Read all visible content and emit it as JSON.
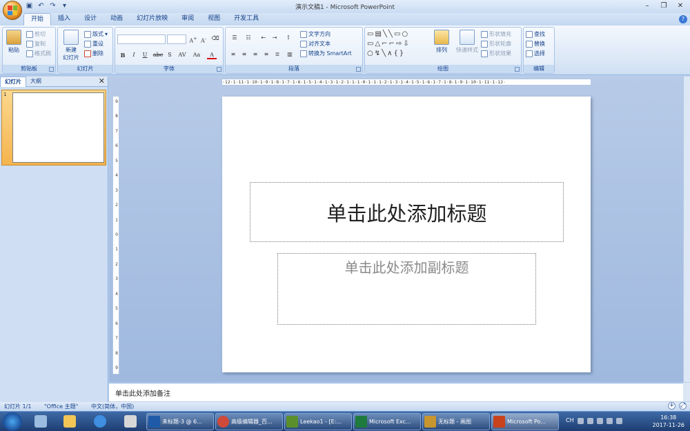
{
  "window": {
    "title": "演示文稿1 - Microsoft PowerPoint"
  },
  "ribbon_tabs": [
    "开始",
    "插入",
    "设计",
    "动画",
    "幻灯片放映",
    "审阅",
    "视图",
    "开发工具"
  ],
  "clipboard": {
    "paste": "粘贴",
    "cut": "剪切",
    "copy": "复制",
    "format_painter": "格式刷",
    "label": "剪贴板"
  },
  "slides": {
    "new_slide": "新建",
    "new_slide2": "幻灯片",
    "layout": "版式",
    "reset": "重设",
    "delete": "删除",
    "label": "幻灯片"
  },
  "font": {
    "label": "字体",
    "bold": "B",
    "italic": "I",
    "underline": "U",
    "strike": "abc",
    "shadow": "S",
    "spacing": "AV",
    "case": "Aa",
    "color": "A"
  },
  "paragraph": {
    "text_direction": "文字方向",
    "align_text": "对齐文本",
    "smartart": "转换为 SmartArt",
    "label": "段落"
  },
  "drawing": {
    "arrange": "排列",
    "quick_styles": "快速样式",
    "shape_fill": "形状填充",
    "shape_outline": "形状轮廓",
    "shape_effects": "形状效果",
    "label": "绘图"
  },
  "editing": {
    "find": "查找",
    "replace": "替换",
    "select": "选择",
    "label": "编辑"
  },
  "left_panel": {
    "tab_slides": "幻灯片",
    "tab_outline": "大纲",
    "close": "✕",
    "slide_number": "1"
  },
  "ruler": {
    "h": "·12·1·11·1·10·1·9·1·8·1·7·1·6·1·5·1·4·1·3·1·2·1·1·1·0·1·1·1·2·1·3·1·4·1·5·1·6·1·7·1·8·1·9·1·10·1·11·1·12·",
    "v": [
      "9",
      "8",
      "7",
      "6",
      "5",
      "4",
      "3",
      "2",
      "1",
      "0",
      "1",
      "2",
      "3",
      "4",
      "5",
      "6",
      "7",
      "8",
      "9"
    ]
  },
  "slide": {
    "title_placeholder": "单击此处添加标题",
    "subtitle_placeholder": "单击此处添加副标题"
  },
  "notes": {
    "placeholder": "单击此处添加备注"
  },
  "statusbar": {
    "slide_count": "幻灯片 1/1",
    "theme": "\"Office 主题\"",
    "language": "中文(简体，中国)"
  },
  "taskbar": {
    "tasks": [
      {
        "label": "未标题-3 @ 6...",
        "color": "#1e5aa8"
      },
      {
        "label": "高级编辑器_百...",
        "color": "#d04a3a"
      },
      {
        "label": "Leekao1 - [E:...",
        "color": "#5b8f2c"
      },
      {
        "label": "Microsoft Exc...",
        "color": "#1f7a3d"
      },
      {
        "label": "无标题 - 画图",
        "color": "#c8952e"
      },
      {
        "label": "Microsoft Po...",
        "color": "#c8421c"
      }
    ],
    "lang": "CH",
    "time": "16:38",
    "date": "2017-11-26"
  }
}
